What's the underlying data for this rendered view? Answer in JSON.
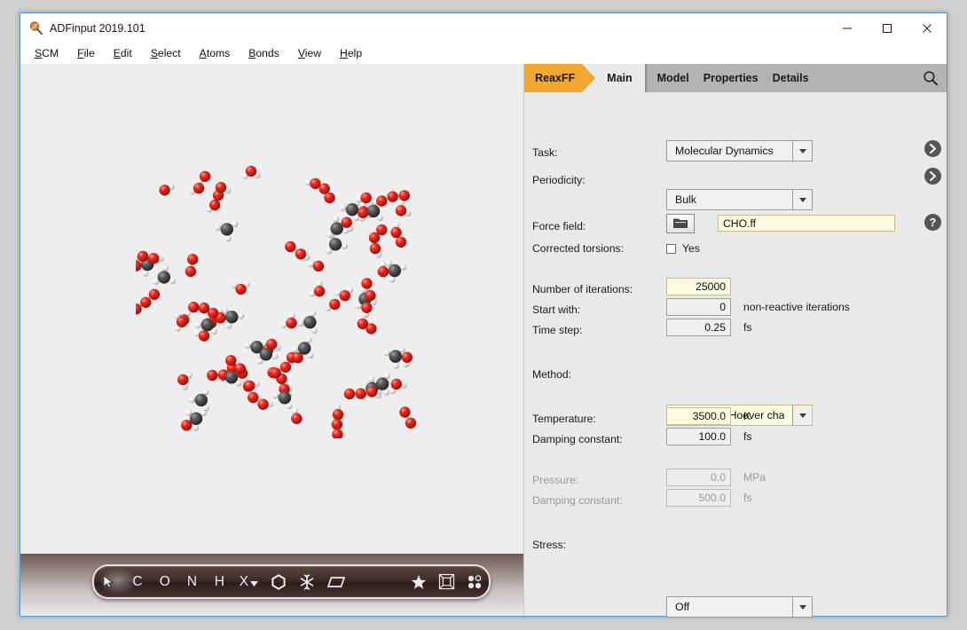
{
  "window": {
    "title": "ADFinput 2019.101",
    "icon": "magnifier-icon",
    "controls": {
      "minimize": "—",
      "maximize": "☐",
      "close": "✕"
    }
  },
  "menubar": {
    "items": [
      {
        "label": "SCM",
        "accel": "S"
      },
      {
        "label": "File",
        "accel": "F"
      },
      {
        "label": "Edit",
        "accel": "E"
      },
      {
        "label": "Select",
        "accel": "S"
      },
      {
        "label": "Atoms",
        "accel": "A"
      },
      {
        "label": "Bonds",
        "accel": "B"
      },
      {
        "label": "View",
        "accel": "V"
      },
      {
        "label": "Help",
        "accel": "H"
      }
    ]
  },
  "tabbar": {
    "module_badge": "ReaxFF",
    "active_tab": "Main",
    "tabs": [
      "Model",
      "Properties",
      "Details"
    ],
    "search_icon": "search-icon",
    "badge_color": "#f0a830"
  },
  "toolbar": {
    "tools": [
      {
        "name": "select-cursor-tool",
        "glyph": "➤",
        "selected": true
      },
      {
        "name": "carbon-tool",
        "glyph": "C"
      },
      {
        "name": "oxygen-tool",
        "glyph": "O"
      },
      {
        "name": "nitrogen-tool",
        "glyph": "N"
      },
      {
        "name": "hydrogen-tool",
        "glyph": "H"
      },
      {
        "name": "other-element-tool",
        "glyph": "X"
      },
      {
        "name": "ring-tool",
        "glyph": "⬡"
      },
      {
        "name": "crystal-tool",
        "glyph": "❅"
      },
      {
        "name": "plane-tool",
        "glyph": "▱"
      },
      {
        "name": "favorites-tool",
        "glyph": "★"
      },
      {
        "name": "unit-cell-tool",
        "glyph": "⧉"
      },
      {
        "name": "atom-dots-tool",
        "glyph": "∷"
      }
    ]
  },
  "form": {
    "task": {
      "label": "Task:",
      "value": "Molecular Dynamics",
      "modified": false
    },
    "periodicity": {
      "label": "Periodicity:",
      "value": "Bulk",
      "modified": false
    },
    "force_field": {
      "label": "Force field:",
      "value": "CHO.ff",
      "browse_icon": "folder-icon",
      "modified": true
    },
    "corrected_torsions": {
      "label": "Corrected torsions:",
      "checkbox_label": "Yes",
      "checked": false
    },
    "iterations": {
      "label": "Number of iterations:",
      "value": "25000",
      "modified": true
    },
    "start_with": {
      "label": "Start with:",
      "value": "0",
      "suffix": "non-reactive iterations",
      "modified": false
    },
    "time_step": {
      "label": "Time step:",
      "value": "0.25",
      "unit": "fs",
      "modified": false
    },
    "method": {
      "label": "Method:",
      "value": "NVT Nose-Hoover cha",
      "modified": true
    },
    "temperature": {
      "label": "Temperature:",
      "value": "3500.0",
      "unit": "K",
      "modified": true
    },
    "damping_constant_t": {
      "label": "Damping constant:",
      "value": "100.0",
      "unit": "fs",
      "modified": false
    },
    "pressure": {
      "label": "Pressure:",
      "value": "0.0",
      "unit": "MPa",
      "disabled": true
    },
    "damping_constant_p": {
      "label": "Damping constant:",
      "value": "500.0",
      "unit": "fs",
      "disabled": true
    },
    "stress": {
      "label": "Stress:",
      "value": "Off",
      "modified": false
    },
    "help_icons": {
      "task": "chevron-right-icon",
      "periodicity": "chevron-right-icon",
      "force_field": "question-mark-icon"
    }
  },
  "viewer": {
    "name": "molecule-3d-view",
    "atom_colors": {
      "oxygen": "#e02020",
      "carbon": "#4a4a4a",
      "hydrogen": "#f2f2f2"
    },
    "background": "#eeeeee"
  }
}
